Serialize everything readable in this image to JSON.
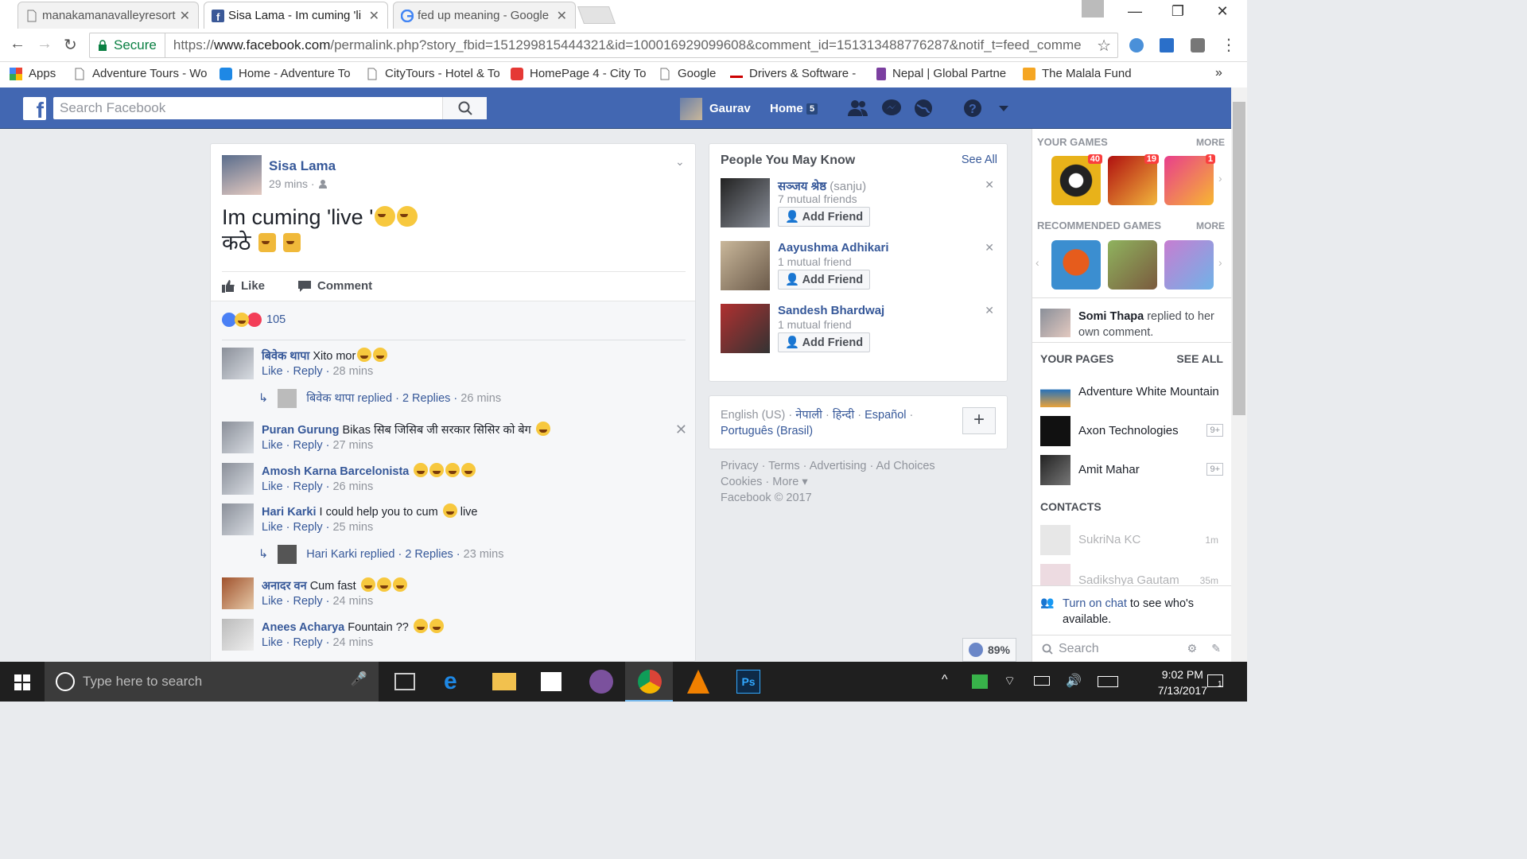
{
  "browser": {
    "tabs": [
      {
        "title": "manakamanavalleyresort",
        "active": false
      },
      {
        "title": "Sisa Lama - Im cuming 'li",
        "active": true
      },
      {
        "title": "fed up meaning - Google",
        "active": false
      }
    ],
    "secure_label": "Secure",
    "url_prefix": "https://",
    "url_domain": "www.facebook.com",
    "url_rest": "/permalink.php?story_fbid=151299815444321&id=100016929099608&comment_id=151313488776287&notif_t=feed_comme",
    "bookmarks": [
      "Apps",
      "Adventure Tours - Wo",
      "Home - Adventure To",
      "CityTours - Hotel & To",
      "HomePage 4 - City To",
      "Google",
      "Drivers & Software -",
      "Nepal | Global Partne",
      "The Malala Fund"
    ],
    "bookmarks_overflow": "»"
  },
  "fb_header": {
    "logo": "f",
    "search_placeholder": "Search Facebook",
    "user_name": "Gaurav",
    "home_label": "Home",
    "home_count": "5"
  },
  "post": {
    "author": "Sisa Lama",
    "time": "29 mins ·",
    "text_line1": "Im cuming 'live '",
    "text_line2": "कठे",
    "like_label": "Like",
    "comment_label": "Comment",
    "reaction_count": "105"
  },
  "comments": [
    {
      "name": "बिवेक थापा",
      "text": "Xito mor",
      "emojis": 2,
      "like": "Like",
      "reply": "Reply",
      "time": "28 mins",
      "replies": {
        "name": "बिवेक थापा replied",
        "count": "2 Replies",
        "time": "26 mins"
      }
    },
    {
      "name": "Puran Gurung",
      "text": "Bikas सिब जिसिब जी सरकार सिसिर को बेग",
      "emojis": 1,
      "like": "Like",
      "reply": "Reply",
      "time": "27 mins"
    },
    {
      "name": "Amosh Karna Barcelonista",
      "text": "",
      "emojis": 4,
      "like": "Like",
      "reply": "Reply",
      "time": "26 mins"
    },
    {
      "name": "Hari Karki",
      "text": "I could help you to cum",
      "text_after": "live",
      "emojis": 0,
      "like": "Like",
      "reply": "Reply",
      "time": "25 mins",
      "replies": {
        "name": "Hari Karki replied",
        "count": "2 Replies",
        "time": "23 mins"
      }
    },
    {
      "name": "अनादर वन",
      "text": "Cum fast",
      "emojis": 3,
      "like": "Like",
      "reply": "Reply",
      "time": "24 mins"
    },
    {
      "name": "Anees Acharya",
      "text": "Fountain ??",
      "emojis": 2,
      "like": "Like",
      "reply": "Reply",
      "time": "24 mins"
    }
  ],
  "pymk": {
    "title": "People You May Know",
    "see_all": "See All",
    "people": [
      {
        "name": "सञ्जय श्रेष्ठ",
        "alias": "(sanju)",
        "mutual": "7 mutual friends",
        "button": "Add Friend"
      },
      {
        "name": "Aayushma Adhikari",
        "alias": "",
        "mutual": "1 mutual friend",
        "button": "Add Friend"
      },
      {
        "name": "Sandesh Bhardwaj",
        "alias": "",
        "mutual": "1 mutual friend",
        "button": "Add Friend"
      }
    ]
  },
  "languages": {
    "current": "English (US) ·",
    "others": [
      "नेपाली",
      "हिन्दी",
      "Español",
      "Português (Brasil)"
    ],
    "add": "+"
  },
  "footer": {
    "line1": "Privacy · Terms · Advertising · Ad Choices",
    "line2": "Cookies · More ▾",
    "line3": "Facebook © 2017"
  },
  "sidebar": {
    "your_games": "YOUR GAMES",
    "more1": "MORE",
    "game_badges": [
      "40",
      "19",
      "1"
    ],
    "recommended_games": "RECOMMENDED GAMES",
    "more2": "MORE",
    "notif_name": "Somi Thapa",
    "notif_text": "replied to her own comment.",
    "your_pages": "YOUR PAGES",
    "see_all": "SEE ALL",
    "pages": [
      {
        "name": "Adventure White Mountain",
        "count": ""
      },
      {
        "name": "Axon Technologies",
        "count": "9+"
      },
      {
        "name": "Amit Mahar",
        "count": "9+"
      }
    ],
    "contacts_title": "CONTACTS",
    "contacts": [
      {
        "name": "SukriNa KC",
        "time": "1m"
      },
      {
        "name": "Sadikshya Gautam",
        "time": "35m"
      }
    ],
    "chat_link": "Turn on chat",
    "chat_text": "to see who's available.",
    "search_placeholder": "Search"
  },
  "zoom_badge": "89%",
  "taskbar": {
    "search_placeholder": "Type here to search",
    "time": "9:02 PM",
    "date": "7/13/2017",
    "notif_count": "1"
  },
  "colors": {
    "fb_blue": "#4267b2",
    "link": "#365899",
    "meta": "#90949c"
  }
}
